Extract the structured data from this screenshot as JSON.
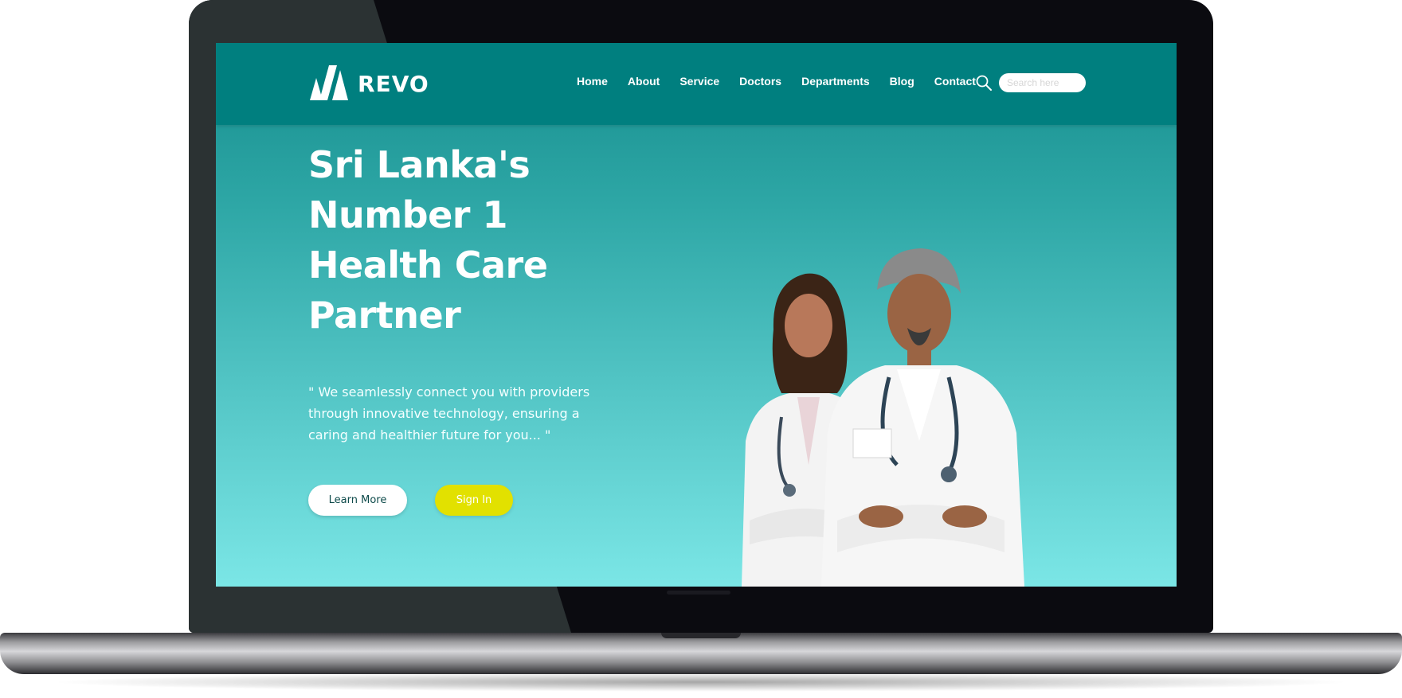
{
  "header": {
    "logo_text": "REVO",
    "nav": [
      "Home",
      "About",
      "Service",
      "Doctors",
      "Departments",
      "Blog",
      "Contact"
    ],
    "search_placeholder": "Search here"
  },
  "hero": {
    "title_lines": [
      "Sri Lanka's",
      "Number 1",
      "Health Care",
      "Partner"
    ],
    "quote": "\" We seamlessly connect you with providers through innovative technology, ensuring a caring and healthier future for you... \"",
    "learn_more": "Learn More",
    "sign_in": "Sign In"
  },
  "colors": {
    "header_bg": "#007f7f",
    "hero_gradient_top": "#158d8d",
    "hero_gradient_bottom": "#7be6e6",
    "sign_in_button": "#e2e100",
    "learn_more_text": "#0d4a4a"
  },
  "icons": [
    "revo-logo-icon",
    "search-icon"
  ],
  "image": "doctors-photo"
}
